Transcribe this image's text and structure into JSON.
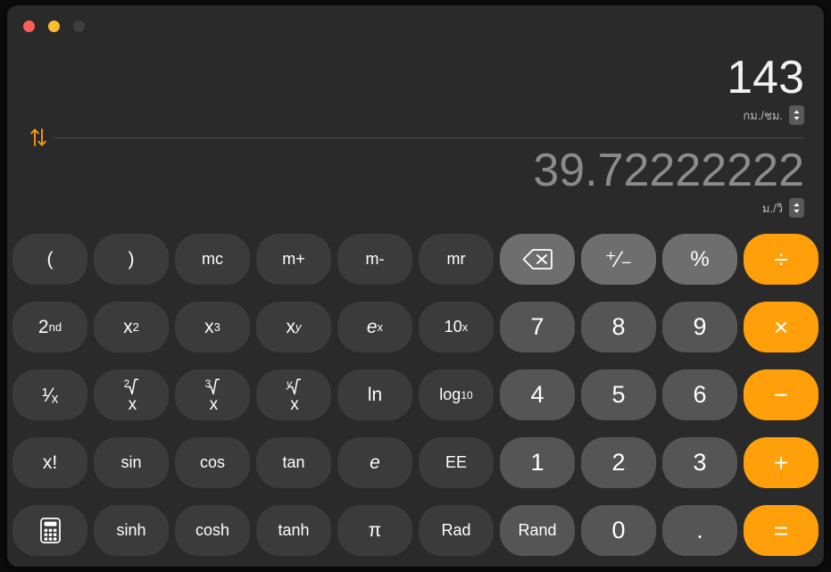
{
  "window": {
    "traffic_lights": [
      {
        "name": "close",
        "color": "#ff5f57"
      },
      {
        "name": "minimize",
        "color": "#ffbd2e"
      },
      {
        "name": "zoom",
        "color": "#3f3f3f"
      }
    ]
  },
  "display": {
    "input": {
      "value": "143",
      "unit": "กม./ชม."
    },
    "output": {
      "value": "39.72222222",
      "unit": "ม./วิ"
    },
    "swap_icon": "up-down-arrows-icon",
    "accent_color": "#ff9f0a"
  },
  "keypad": {
    "rows": [
      [
        {
          "label": "(",
          "style": "fn",
          "name": "open-paren"
        },
        {
          "label": ")",
          "style": "fn",
          "name": "close-paren"
        },
        {
          "label": "mc",
          "style": "fn",
          "name": "memory-clear"
        },
        {
          "label": "m+",
          "style": "fn",
          "name": "memory-add"
        },
        {
          "label": "m-",
          "style": "fn",
          "name": "memory-subtract"
        },
        {
          "label": "mr",
          "style": "fn",
          "name": "memory-recall"
        },
        {
          "label": "",
          "style": "util",
          "name": "delete",
          "icon": "delete-backspace-icon"
        },
        {
          "label": "+/-",
          "style": "util",
          "name": "sign-toggle"
        },
        {
          "label": "%",
          "style": "util",
          "name": "percent"
        },
        {
          "label": "÷",
          "style": "op",
          "name": "divide"
        }
      ],
      [
        {
          "label": "2nd",
          "style": "fn",
          "name": "second-function"
        },
        {
          "label": "x2",
          "style": "fn",
          "name": "x-squared"
        },
        {
          "label": "x3",
          "style": "fn",
          "name": "x-cubed"
        },
        {
          "label": "xy",
          "style": "fn",
          "name": "x-to-the-y"
        },
        {
          "label": "ex",
          "style": "fn",
          "name": "e-to-the-x"
        },
        {
          "label": "10x",
          "style": "fn",
          "name": "ten-to-the-x"
        },
        {
          "label": "7",
          "style": "digit",
          "name": "digit-7"
        },
        {
          "label": "8",
          "style": "digit",
          "name": "digit-8"
        },
        {
          "label": "9",
          "style": "digit",
          "name": "digit-9"
        },
        {
          "label": "×",
          "style": "op",
          "name": "multiply"
        }
      ],
      [
        {
          "label": "1/x",
          "style": "fn",
          "name": "reciprocal"
        },
        {
          "label": "sqrt2",
          "style": "fn",
          "name": "square-root"
        },
        {
          "label": "sqrt3",
          "style": "fn",
          "name": "cube-root"
        },
        {
          "label": "sqrty",
          "style": "fn",
          "name": "y-root"
        },
        {
          "label": "ln",
          "style": "fn",
          "name": "natural-log"
        },
        {
          "label": "log10",
          "style": "fn",
          "name": "log-base-10"
        },
        {
          "label": "4",
          "style": "digit",
          "name": "digit-4"
        },
        {
          "label": "5",
          "style": "digit",
          "name": "digit-5"
        },
        {
          "label": "6",
          "style": "digit",
          "name": "digit-6"
        },
        {
          "label": "−",
          "style": "op",
          "name": "subtract"
        }
      ],
      [
        {
          "label": "x!",
          "style": "fn",
          "name": "factorial"
        },
        {
          "label": "sin",
          "style": "fn",
          "name": "sine"
        },
        {
          "label": "cos",
          "style": "fn",
          "name": "cosine"
        },
        {
          "label": "tan",
          "style": "fn",
          "name": "tangent"
        },
        {
          "label": "e",
          "style": "fn",
          "name": "euler-number"
        },
        {
          "label": "EE",
          "style": "fn",
          "name": "exponent-entry"
        },
        {
          "label": "1",
          "style": "digit",
          "name": "digit-1"
        },
        {
          "label": "2",
          "style": "digit",
          "name": "digit-2"
        },
        {
          "label": "3",
          "style": "digit",
          "name": "digit-3"
        },
        {
          "label": "+",
          "style": "op",
          "name": "add"
        }
      ],
      [
        {
          "label": "",
          "style": "fn",
          "name": "calculator-mode",
          "icon": "calculator-icon"
        },
        {
          "label": "sinh",
          "style": "fn",
          "name": "hyperbolic-sine"
        },
        {
          "label": "cosh",
          "style": "fn",
          "name": "hyperbolic-cosine"
        },
        {
          "label": "tanh",
          "style": "fn",
          "name": "hyperbolic-tangent"
        },
        {
          "label": "π",
          "style": "fn",
          "name": "pi"
        },
        {
          "label": "Rad",
          "style": "fn",
          "name": "radians-toggle"
        },
        {
          "label": "Rand",
          "style": "digit",
          "name": "random"
        },
        {
          "label": "0",
          "style": "digit",
          "name": "digit-0"
        },
        {
          "label": ".",
          "style": "digit",
          "name": "decimal-point"
        },
        {
          "label": "=",
          "style": "op",
          "name": "equals"
        }
      ]
    ]
  }
}
